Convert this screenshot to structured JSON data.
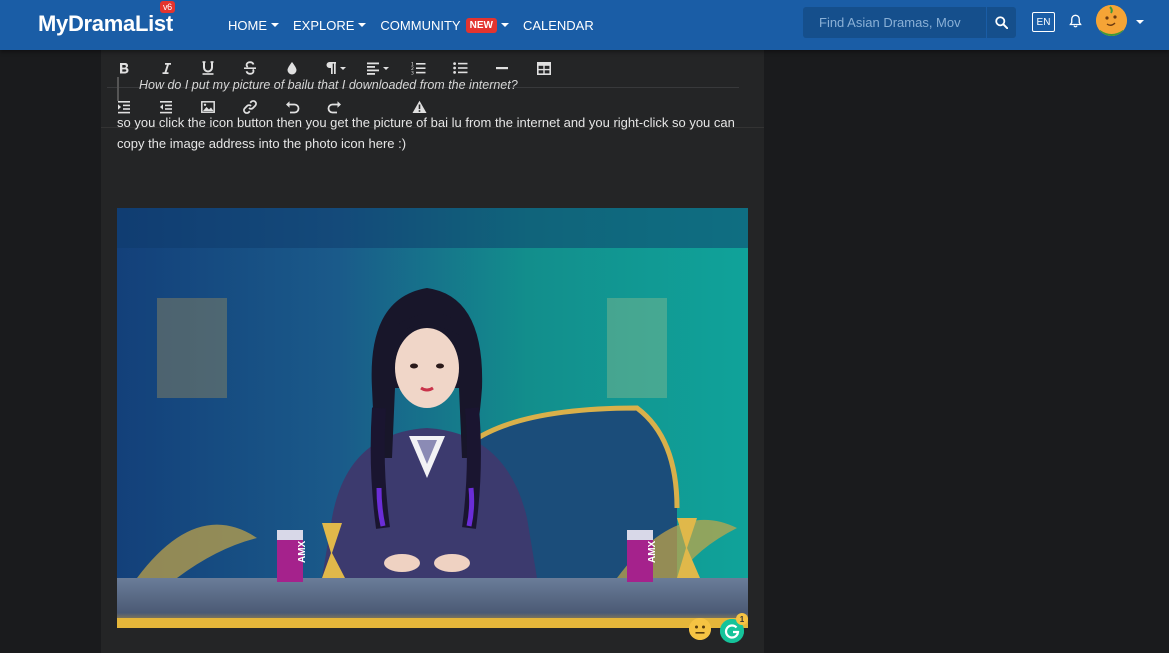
{
  "navbar": {
    "logo_text": "MyDramaList",
    "logo_badge": "v6",
    "menu": [
      {
        "label": "HOME",
        "caret": true
      },
      {
        "label": "EXPLORE",
        "caret": true
      },
      {
        "label": "COMMUNITY",
        "caret": true,
        "badge": "NEW"
      },
      {
        "label": "CALENDAR",
        "caret": false
      }
    ],
    "search_placeholder": "Find Asian Dramas, Mov",
    "language": "EN",
    "brand_color": "#1a5da6"
  },
  "toolbar": {
    "row1": [
      "bold-icon",
      "italic-icon",
      "underline-icon",
      "strikethrough-icon",
      "text-color-icon",
      "paragraph-format-icon",
      "align-icon",
      "ordered-list-icon",
      "unordered-list-icon",
      "horizontal-line-icon",
      "table-icon"
    ],
    "row2": [
      "indent-icon",
      "outdent-icon",
      "insert-image-icon",
      "insert-link-icon",
      "undo-icon",
      "redo-icon",
      "warning-icon"
    ]
  },
  "post": {
    "quote": "How do I put my picture of bailu that I downloaded from the internet?",
    "body": "so you click the icon button then you get the picture of bai lu from the internet and you right-click so you can copy the image address into the photo icon here :)"
  },
  "grammarly": {
    "count": "1"
  }
}
